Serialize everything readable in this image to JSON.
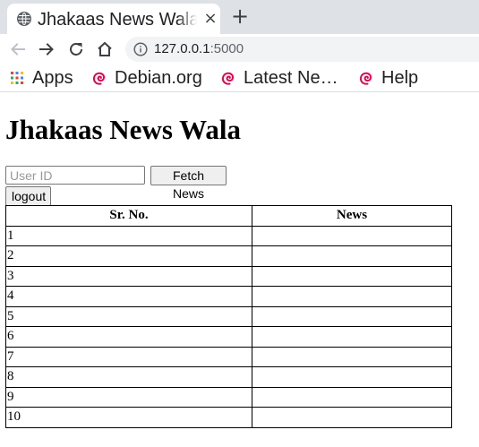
{
  "browser": {
    "tab_title": "Jhakaas News Wala",
    "close_glyph": "×",
    "new_tab_glyph": "+",
    "url_host": "127.0.0.1",
    "url_port": ":5000",
    "bookmarks": [
      {
        "label": "Apps",
        "icon": "apps-grid-icon"
      },
      {
        "label": "Debian.org",
        "icon": "debian-swirl-icon"
      },
      {
        "label": "Latest Ne…",
        "icon": "debian-swirl-icon"
      },
      {
        "label": "Help",
        "icon": "debian-swirl-icon"
      }
    ]
  },
  "page": {
    "heading": "Jhakaas News Wala",
    "userid_placeholder": "User ID",
    "userid_value": "",
    "fetch_button": "Fetch News",
    "logout_button": "logout",
    "table": {
      "headers": [
        "Sr. No.",
        "News"
      ],
      "rows": [
        [
          "1",
          ""
        ],
        [
          "2",
          ""
        ],
        [
          "3",
          ""
        ],
        [
          "4",
          ""
        ],
        [
          "5",
          ""
        ],
        [
          "6",
          ""
        ],
        [
          "7",
          ""
        ],
        [
          "8",
          ""
        ],
        [
          "9",
          ""
        ],
        [
          "10",
          ""
        ]
      ]
    }
  },
  "colors": {
    "tabstrip": "#dee1e6",
    "omnibox": "#f1f3f4",
    "debian_red": "#d70751"
  }
}
